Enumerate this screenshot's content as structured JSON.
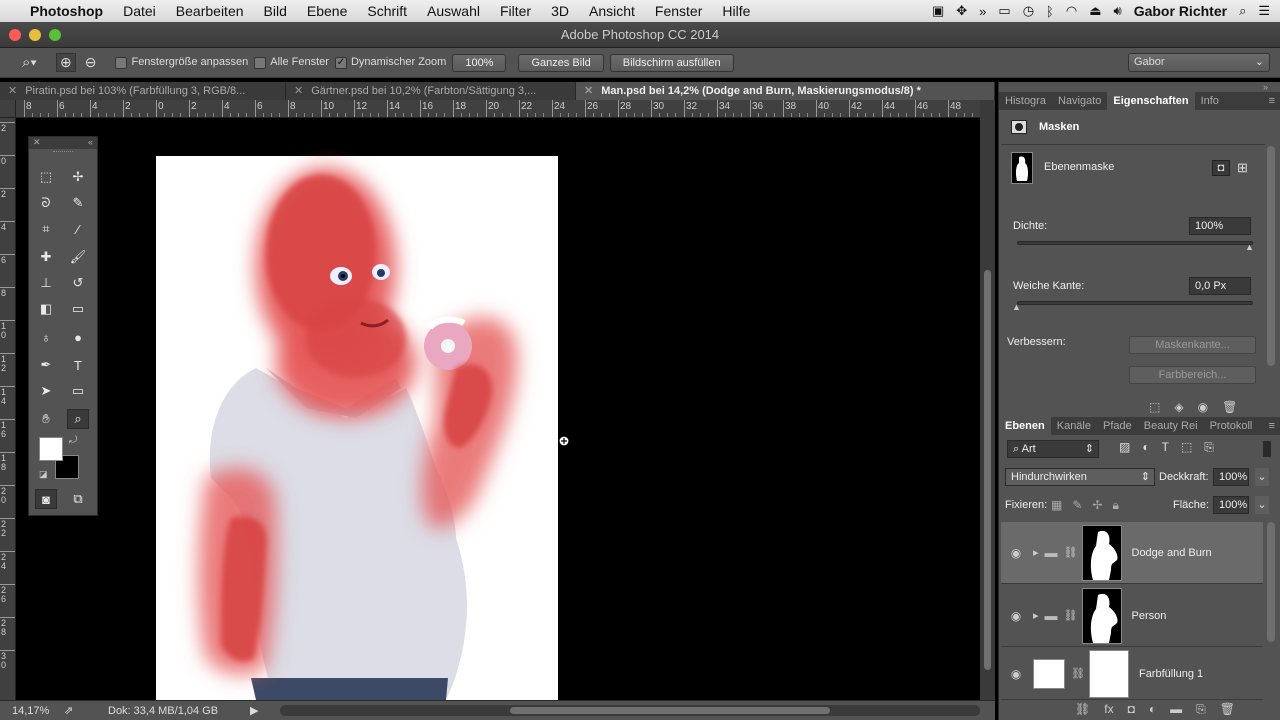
{
  "menubar": {
    "apple": "",
    "app": "Photoshop",
    "items": [
      "Datei",
      "Bearbeiten",
      "Bild",
      "Ebene",
      "Schrift",
      "Auswahl",
      "Filter",
      "3D",
      "Ansicht",
      "Fenster",
      "Hilfe"
    ],
    "user": "Gabor Richter"
  },
  "window": {
    "title": "Adobe Photoshop CC 2014"
  },
  "options": {
    "fit_window": "Fenstergröße anpassen",
    "all_windows": "Alle Fenster",
    "dyn_zoom": "Dynamischer Zoom",
    "zoom_value": "100%",
    "whole_image": "Ganzes Bild",
    "fill_screen": "Bildschirm ausfüllen",
    "workspace": "Gabor"
  },
  "tabs": [
    {
      "label": "Piratin.psd bei 103% (Farbfüllung 3, RGB/8..."
    },
    {
      "label": "Gärtner.psd bei 10,2% (Farbton/Sättigung 3,..."
    },
    {
      "label": "Man.psd bei 14,2% (Dodge and Burn, Maskierungsmodus/8) *"
    }
  ],
  "ruler": {
    "h": [
      "8",
      "6",
      "4",
      "2",
      "0",
      "2",
      "4",
      "6",
      "8",
      "10",
      "12",
      "14",
      "16",
      "18",
      "20",
      "22",
      "24",
      "26",
      "28",
      "30",
      "32",
      "34",
      "36",
      "38",
      "40",
      "42",
      "44",
      "46",
      "48"
    ],
    "v": [
      "2",
      "0",
      "2",
      "4",
      "6",
      "8",
      "1 0",
      "1 2",
      "1 4",
      "1 6",
      "1 8",
      "2 0",
      "2 2",
      "2 4",
      "2 6",
      "2 8",
      "3 0"
    ]
  },
  "status": {
    "zoom": "14,17%",
    "doc": "Dok: 33,4 MB/1,04 GB"
  },
  "props_panel": {
    "tabs": [
      "Histogra",
      "Navigato",
      "Eigenschaften",
      "Info"
    ],
    "header": "Masken",
    "mask_label": "Ebenenmaske",
    "density_label": "Dichte:",
    "density_value": "100%",
    "feather_label": "Weiche Kante:",
    "feather_value": "0,0 Px",
    "refine_label": "Verbessern:",
    "mask_edge": "Maskenkante...",
    "color_range": "Farbbereich..."
  },
  "layers_panel": {
    "tabs": [
      "Ebenen",
      "Kanäle",
      "Pfade",
      "Beauty Rei",
      "Protokoll"
    ],
    "filter": "Art",
    "blend": "Hindurchwirken",
    "opacity_label": "Deckkraft:",
    "opacity_value": "100%",
    "lock_label": "Fixieren:",
    "fill_label": "Fläche:",
    "fill_value": "100%",
    "layers": [
      {
        "name": "Dodge and Burn"
      },
      {
        "name": "Person"
      },
      {
        "name": "Farbfüllung 1"
      }
    ]
  },
  "colors": {
    "accent": "#e05353",
    "panel": "#535353",
    "dark": "#3a3a3a"
  }
}
